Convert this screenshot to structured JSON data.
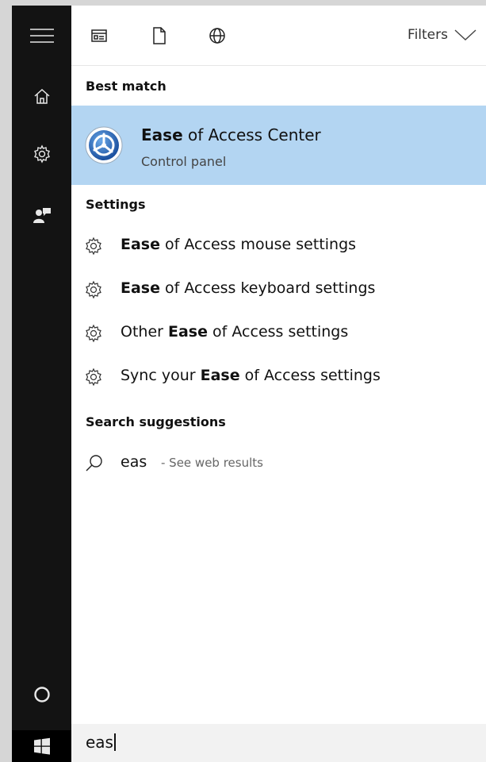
{
  "rail": {
    "icons": [
      "hamburger-menu-icon",
      "home-icon",
      "settings-gear-icon",
      "feedback-person-icon",
      "cortana-circle-icon",
      "windows-start-icon"
    ]
  },
  "topbar": {
    "icons": [
      "apps-filter-icon",
      "documents-filter-icon",
      "web-filter-icon"
    ],
    "filters_label": "Filters"
  },
  "best_match": {
    "heading": "Best match",
    "title_bold": "Ease",
    "title_rest": " of Access Center",
    "subtitle": "Control panel",
    "highlight_color": "#b3d5f2"
  },
  "settings": {
    "heading": "Settings",
    "items": [
      {
        "pre": "",
        "bold": "Ease",
        "post": " of Access mouse settings"
      },
      {
        "pre": "",
        "bold": "Ease",
        "post": " of Access keyboard settings"
      },
      {
        "pre": "Other ",
        "bold": "Ease",
        "post": " of Access settings"
      },
      {
        "pre": "Sync your ",
        "bold": "Ease",
        "post": " of Access settings"
      }
    ]
  },
  "suggestions": {
    "heading": "Search suggestions",
    "query": "eas",
    "hint": " - See web results"
  },
  "search": {
    "value": "eas"
  }
}
